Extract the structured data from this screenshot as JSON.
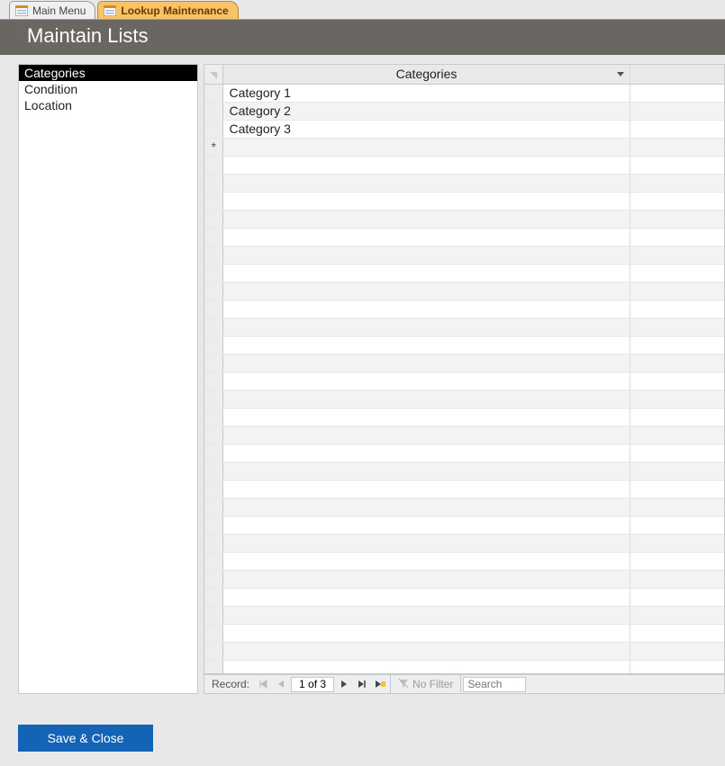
{
  "tabs": [
    {
      "label": "Main Menu",
      "active": false
    },
    {
      "label": "Lookup Maintenance",
      "active": true
    }
  ],
  "header": {
    "title": "Maintain Lists"
  },
  "sidebar": {
    "items": [
      {
        "label": "Categories",
        "selected": true
      },
      {
        "label": "Condition",
        "selected": false
      },
      {
        "label": "Location",
        "selected": false
      }
    ]
  },
  "grid": {
    "column_header": "Categories",
    "rows": [
      {
        "value": "Category 1"
      },
      {
        "value": "Category 2"
      },
      {
        "value": "Category 3"
      }
    ]
  },
  "record_nav": {
    "label": "Record:",
    "position": "1 of 3",
    "filter_label": "No Filter",
    "search_placeholder": "Search"
  },
  "buttons": {
    "save_close": "Save & Close"
  }
}
